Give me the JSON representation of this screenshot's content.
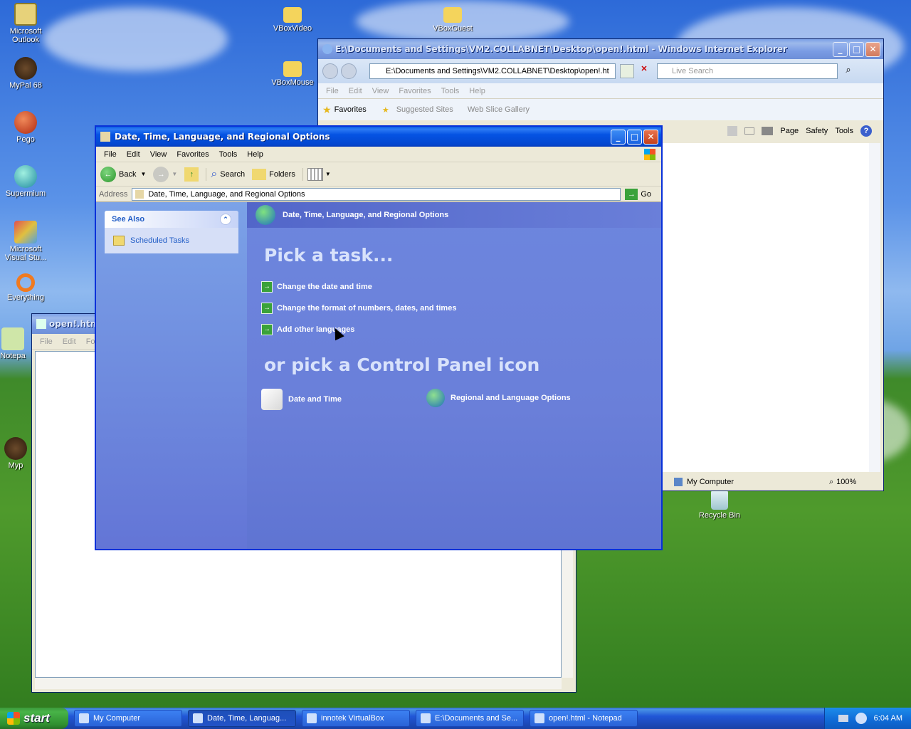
{
  "desktop_icons": [
    {
      "label": "Microsoft Outlook"
    },
    {
      "label": "MyPal 68"
    },
    {
      "label": "Pego"
    },
    {
      "label": "Supermium"
    },
    {
      "label": "Microsoft Visual Stu..."
    },
    {
      "label": "Everything"
    },
    {
      "label": "Notepa"
    },
    {
      "label": "Myp"
    },
    {
      "label": "VBoxVideo"
    },
    {
      "label": "VBoxMouse"
    },
    {
      "label": "VBoxGuest"
    },
    {
      "label": "Recycle Bin"
    }
  ],
  "ie": {
    "title": "E:\\Documents and Settings\\VM2.COLLABNET\\Desktop\\open!.html - Windows Internet Explorer",
    "address": "E:\\Documents and Settings\\VM2.COLLABNET\\Desktop\\open!.ht",
    "search_placeholder": "Live Search",
    "menu": [
      "File",
      "Edit",
      "View",
      "Favorites",
      "Tools",
      "Help"
    ],
    "favorites": "Favorites",
    "suggested_sites": "Suggested Sites",
    "web_slice": "Web Slice Gallery",
    "cmd_page": "Page",
    "cmd_safety": "Safety",
    "cmd_tools": "Tools",
    "status_zone": "My Computer",
    "zoom": "100%"
  },
  "notepad": {
    "title": "open!.htm",
    "menu": [
      "File",
      "Edit",
      "Form"
    ]
  },
  "cp": {
    "title": "Date, Time, Language, and Regional Options",
    "menu": [
      "File",
      "Edit",
      "View",
      "Favorites",
      "Tools",
      "Help"
    ],
    "back": "Back",
    "search": "Search",
    "folders": "Folders",
    "address_label": "Address",
    "address_value": "Date, Time, Language, and Regional Options",
    "go": "Go",
    "see_also": "See Also",
    "scheduled_tasks": "Scheduled Tasks",
    "header": "Date, Time, Language, and Regional Options",
    "pick_task": "Pick a task...",
    "tasks": [
      "Change the date and time",
      "Change the format of numbers, dates, and times",
      "Add other languages"
    ],
    "or_pick": "or pick a Control Panel icon",
    "icons": [
      "Date and Time",
      "Regional and Language Options"
    ]
  },
  "taskbar": {
    "start": "start",
    "items": [
      "My Computer",
      "Date, Time, Languag...",
      "innotek VirtualBox",
      "E:\\Documents and Se...",
      "open!.html - Notepad"
    ],
    "clock": "6:04 AM"
  }
}
